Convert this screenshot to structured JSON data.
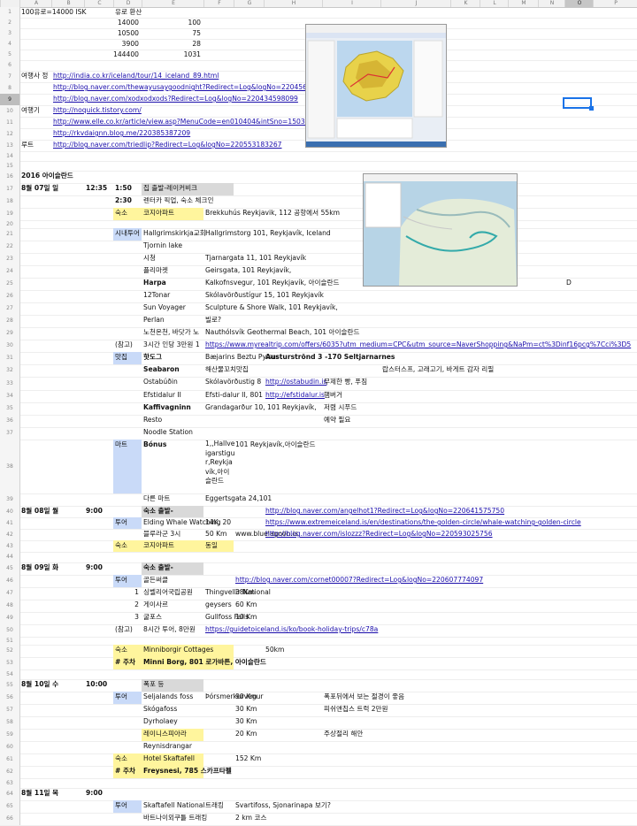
{
  "columns": [
    "A",
    "B",
    "C",
    "D",
    "E",
    "F",
    "G",
    "H",
    "I",
    "J",
    "K",
    "L",
    "M",
    "N",
    "O",
    "P"
  ],
  "selected_column": "O",
  "selected_row": 9,
  "colors": {
    "grey": "#d9d9d9",
    "yellow": "#fff59d",
    "blue": "#c9daf8",
    "link": "#1a0dab"
  },
  "rows": [
    {
      "n": 1,
      "h": 12,
      "cells": [
        {
          "c": "A",
          "t": "100유로=14000 ISK"
        },
        {
          "c": "D",
          "t": "유로 환산"
        }
      ]
    },
    {
      "n": 2,
      "h": 12,
      "cells": [
        {
          "c": "D",
          "t": "14000",
          "align": "r"
        },
        {
          "c": "E",
          "t": "100",
          "align": "r"
        }
      ]
    },
    {
      "n": 3,
      "h": 12,
      "cells": [
        {
          "c": "D",
          "t": "10500",
          "align": "r"
        },
        {
          "c": "E",
          "t": "75",
          "align": "r"
        }
      ]
    },
    {
      "n": 4,
      "h": 12,
      "cells": [
        {
          "c": "D",
          "t": "3900",
          "align": "r"
        },
        {
          "c": "E",
          "t": "28",
          "align": "r"
        }
      ]
    },
    {
      "n": 5,
      "h": 12,
      "cells": [
        {
          "c": "D",
          "t": "144400",
          "align": "r"
        },
        {
          "c": "E",
          "t": "1031",
          "align": "r"
        }
      ]
    },
    {
      "n": 6,
      "h": 12,
      "cells": []
    },
    {
      "n": 7,
      "h": 13,
      "cells": [
        {
          "c": "A",
          "t": "여행사 정"
        },
        {
          "c": "B",
          "t": "http://india.co.kr/iceland/tour/14_iceland_89.html",
          "link": true
        }
      ]
    },
    {
      "n": 8,
      "h": 13,
      "cells": [
        {
          "c": "B",
          "t": "http://blog.naver.com/thewayusaygoodnight?Redirect=Log&logNo=2204564",
          "link": true
        }
      ]
    },
    {
      "n": 9,
      "h": 13,
      "cells": [
        {
          "c": "B",
          "t": "http://blog.naver.com/xodxodxods?Redirect=Log&logNo=220434598099",
          "link": true
        }
      ]
    },
    {
      "n": 10,
      "h": 13,
      "cells": [
        {
          "c": "A",
          "t": "여행기"
        },
        {
          "c": "B",
          "t": "http://noquick.tistory.com/",
          "link": true
        }
      ]
    },
    {
      "n": 11,
      "h": 13,
      "cells": [
        {
          "c": "B",
          "t": "http://www.elle.co.kr/article/view.asp?MenuCode=en010404&intSno=15037",
          "link": true
        }
      ]
    },
    {
      "n": 12,
      "h": 13,
      "cells": [
        {
          "c": "B",
          "t": "http://rkvdaignn.blog.me/220385387209",
          "link": true
        }
      ]
    },
    {
      "n": 13,
      "h": 13,
      "cells": [
        {
          "c": "A",
          "t": "루트"
        },
        {
          "c": "B",
          "t": "http://blog.naver.com/triedlip?Redirect=Log&logNo=220553183267",
          "link": true
        }
      ]
    },
    {
      "n": 14,
      "h": 11,
      "cells": []
    },
    {
      "n": 15,
      "h": 11,
      "cells": []
    },
    {
      "n": 16,
      "h": 14,
      "cells": [
        {
          "c": "A",
          "t": "2016 아이슬란드",
          "bold": true
        }
      ]
    },
    {
      "n": 17,
      "h": 14,
      "cells": [
        {
          "c": "A",
          "t": "8월 07일 일",
          "bold": true
        },
        {
          "c": "C",
          "t": "12:35",
          "bold": true
        },
        {
          "c": "D",
          "t": "1:50",
          "bold": true
        },
        {
          "c": "E",
          "t": "집 출발-레이커비크",
          "fill": "grey",
          "span": 2
        }
      ]
    },
    {
      "n": 18,
      "h": 14,
      "cells": [
        {
          "c": "D",
          "t": "2:30",
          "bold": true
        },
        {
          "c": "E",
          "t": "렌터카 픽업, 숙소 체크인"
        }
      ]
    },
    {
      "n": 19,
      "h": 14,
      "cells": [
        {
          "c": "D",
          "t": "숙소",
          "fill": "yellow"
        },
        {
          "c": "E",
          "t": "코지아파트",
          "fill": "yellow"
        },
        {
          "c": "F",
          "t": "Brekkuhús Reykjavik, 112 공항에서 55km"
        }
      ]
    },
    {
      "n": 20,
      "h": 9,
      "cells": []
    },
    {
      "n": 21,
      "h": 14,
      "cells": [
        {
          "c": "D",
          "t": "시내투어",
          "fill": "blue"
        },
        {
          "c": "E",
          "t": "Hallgrimskirkja교회"
        },
        {
          "c": "F",
          "t": "Hallgrimstorg 101, Reykjavík, Iceland"
        }
      ]
    },
    {
      "n": 22,
      "h": 14,
      "cells": [
        {
          "c": "E",
          "t": "Tjornin lake"
        }
      ]
    },
    {
      "n": 23,
      "h": 14,
      "cells": [
        {
          "c": "E",
          "t": "시청"
        },
        {
          "c": "F",
          "t": "Tjarnargata 11, 101 Reykjavík"
        }
      ]
    },
    {
      "n": 24,
      "h": 14,
      "cells": [
        {
          "c": "E",
          "t": "플리마켓"
        },
        {
          "c": "F",
          "t": "Geirsgata, 101 Reykjavík,"
        }
      ]
    },
    {
      "n": 25,
      "h": 14,
      "cells": [
        {
          "c": "E",
          "t": "Harpa",
          "bold": true
        },
        {
          "c": "F",
          "t": "Kalkofnsvegur, 101 Reykjavík, 아이슬란드"
        },
        {
          "c": "O",
          "t": "D"
        }
      ]
    },
    {
      "n": 26,
      "h": 14,
      "cells": [
        {
          "c": "E",
          "t": "12Tonar"
        },
        {
          "c": "F",
          "t": "Skólavörðustígur 15, 101 Reykjavík"
        }
      ]
    },
    {
      "n": 27,
      "h": 14,
      "cells": [
        {
          "c": "E",
          "t": "Sun Voyager"
        },
        {
          "c": "F",
          "t": "Sculpture & Shore Walk, 101 Reykjavík,"
        }
      ]
    },
    {
      "n": 28,
      "h": 14,
      "cells": [
        {
          "c": "E",
          "t": "Perlan"
        },
        {
          "c": "F",
          "t": "빌로?"
        }
      ]
    },
    {
      "n": 29,
      "h": 14,
      "cells": [
        {
          "c": "E",
          "t": "노천온천, 바닷가 노"
        },
        {
          "c": "F",
          "t": "Nauthólsvík Geothermal Beach, 101 아이슬란드"
        }
      ]
    },
    {
      "n": 30,
      "h": 14,
      "cells": [
        {
          "c": "D",
          "t": "(참고)"
        },
        {
          "c": "E",
          "t": "3시간 인당 3만원 1"
        },
        {
          "c": "F",
          "t": "https://www.myrealtrip.com/offers/6035?utm_medium=CPC&utm_source=NaverShopping&NaPm=ct%3Dinf16pcg%7Cci%3D5",
          "link": true
        }
      ]
    },
    {
      "n": 31,
      "h": 14,
      "cells": [
        {
          "c": "D",
          "t": "맛집",
          "fill": "blue"
        },
        {
          "c": "E",
          "t": "핫도그",
          "bold": true
        },
        {
          "c": "F",
          "t": "Bæjarins Beztu Pylsur"
        },
        {
          "c": "H",
          "t": "Austurströnd 3 -170 Seltjarnarnes",
          "bold": true
        }
      ]
    },
    {
      "n": 32,
      "h": 14,
      "cells": [
        {
          "c": "E",
          "t": "Seabaron",
          "bold": true
        },
        {
          "c": "F",
          "t": "해산물꼬치맛집"
        },
        {
          "c": "J",
          "t": "랍스터스프, 고래고기, 바게트 감자 리필"
        }
      ]
    },
    {
      "n": 33,
      "h": 15,
      "cells": [
        {
          "c": "E",
          "t": "Ostabúðin"
        },
        {
          "c": "F",
          "t": "Skólavörðustig 8"
        },
        {
          "c": "H",
          "t": "http://ostabudin.is",
          "link": true
        },
        {
          "c": "I",
          "t": "무제한 빵, 푸짐"
        }
      ]
    },
    {
      "n": 34,
      "h": 14,
      "cells": [
        {
          "c": "E",
          "t": "Efstidalur II"
        },
        {
          "c": "F",
          "t": "Efsti-dalur II, 801"
        },
        {
          "c": "H",
          "t": "http://efstidalur.is",
          "link": true
        },
        {
          "c": "I",
          "t": "햄버거"
        }
      ]
    },
    {
      "n": 35,
      "h": 14,
      "cells": [
        {
          "c": "E",
          "t": "Kaffivagninn",
          "bold": true
        },
        {
          "c": "F",
          "t": "Grandagarður 10, 101 Reykjavík,"
        },
        {
          "c": "I",
          "t": "저렴 시푸드"
        }
      ]
    },
    {
      "n": 36,
      "h": 14,
      "cells": [
        {
          "c": "E",
          "t": "Resto"
        },
        {
          "c": "I",
          "t": "예약 필요"
        }
      ]
    },
    {
      "n": 37,
      "h": 14,
      "cells": [
        {
          "c": "E",
          "t": "Noodle Station"
        }
      ]
    },
    {
      "n": 38,
      "h": 61,
      "cells": [
        {
          "c": "D",
          "t": "마트",
          "fill": "blue"
        },
        {
          "c": "E",
          "t": "Bónus",
          "bold": true
        },
        {
          "c": "F",
          "t": "1,,Hallveigarstigur,Reykjavík,아이슬란드",
          "wrap": true
        },
        {
          "c": "G",
          "t": "101 Reykjavík,아이슬란드"
        }
      ]
    },
    {
      "n": 39,
      "h": 14,
      "cells": [
        {
          "c": "E",
          "t": "다른 마트"
        },
        {
          "c": "F",
          "t": "Eggertsgata 24,101"
        }
      ]
    },
    {
      "n": 40,
      "h": 13,
      "cells": [
        {
          "c": "A",
          "t": "8월 08일 월",
          "bold": true
        },
        {
          "c": "C",
          "t": "9:00",
          "bold": true
        },
        {
          "c": "E",
          "t": "숙소 출발-",
          "fill": "grey",
          "bold": true
        },
        {
          "c": "H",
          "t": "http://blog.naver.com/angelhot1?Redirect=Log&logNo=220641575750",
          "link": true
        }
      ]
    },
    {
      "n": 41,
      "h": 13,
      "cells": [
        {
          "c": "D",
          "t": "투어",
          "fill": "blue"
        },
        {
          "c": "E",
          "t": "Elding Whale Watching"
        },
        {
          "c": "F",
          "t": "14K, 20"
        },
        {
          "c": "H",
          "t": "https://www.extremeiceland.is/en/destinations/the-golden-circle/whale-watching-golden-circle",
          "link": true
        }
      ]
    },
    {
      "n": 42,
      "h": 13,
      "cells": [
        {
          "c": "E",
          "t": "블루라군 3시"
        },
        {
          "c": "F",
          "t": "50 Km"
        },
        {
          "c": "G",
          "t": "www.bluelagoon.is"
        },
        {
          "c": "H",
          "t": "http://blog.naver.com/islozzz?Redirect=Log&logNo=220593025756",
          "link": true
        }
      ]
    },
    {
      "n": 43,
      "h": 13,
      "cells": [
        {
          "c": "D",
          "t": "숙소",
          "fill": "yellow"
        },
        {
          "c": "E",
          "t": "코지아파트",
          "fill": "yellow"
        },
        {
          "c": "F",
          "t": "동일",
          "fill": "yellow"
        }
      ]
    },
    {
      "n": 44,
      "h": 12,
      "cells": []
    },
    {
      "n": 45,
      "h": 14,
      "cells": [
        {
          "c": "A",
          "t": "8월 09일 화",
          "bold": true
        },
        {
          "c": "C",
          "t": "9:00",
          "bold": true
        },
        {
          "c": "E",
          "t": "숙소 출발-",
          "fill": "grey",
          "bold": true
        }
      ]
    },
    {
      "n": 46,
      "h": 14,
      "cells": [
        {
          "c": "D",
          "t": "투어",
          "fill": "blue"
        },
        {
          "c": "E",
          "t": "골든써클"
        },
        {
          "c": "G",
          "t": "http://blog.naver.com/cornet00007?Redirect=Log&logNo=220607774097",
          "link": true
        }
      ]
    },
    {
      "n": 47,
      "h": 14,
      "cells": [
        {
          "c": "D",
          "t": "1",
          "align": "r"
        },
        {
          "c": "E",
          "t": "싱벨리어국립공원"
        },
        {
          "c": "F",
          "t": "Thingvellir National"
        },
        {
          "c": "G",
          "t": "38Km"
        }
      ]
    },
    {
      "n": 48,
      "h": 14,
      "cells": [
        {
          "c": "D",
          "t": "2",
          "align": "r"
        },
        {
          "c": "E",
          "t": "게이사르"
        },
        {
          "c": "F",
          "t": "geysers"
        },
        {
          "c": "G",
          "t": "60 Km"
        }
      ]
    },
    {
      "n": 49,
      "h": 14,
      "cells": [
        {
          "c": "D",
          "t": "3",
          "align": "r"
        },
        {
          "c": "E",
          "t": "굴포스"
        },
        {
          "c": "F",
          "t": "Gullfoss Falls"
        },
        {
          "c": "G",
          "t": "10 Km"
        }
      ]
    },
    {
      "n": 50,
      "h": 14,
      "cells": [
        {
          "c": "D",
          "t": "(참고)"
        },
        {
          "c": "E",
          "t": "8시간 투어, 8만원"
        },
        {
          "c": "F",
          "t": "https://guidetoiceland.is/ko/book-holiday-trips/c78a",
          "link": true
        }
      ]
    },
    {
      "n": 51,
      "h": 9,
      "cells": []
    },
    {
      "n": 52,
      "h": 14,
      "cells": [
        {
          "c": "D",
          "t": "숙소",
          "fill": "yellow"
        },
        {
          "c": "E",
          "t": "Minniborgir Cottages",
          "fill": "yellow",
          "span": 2
        },
        {
          "c": "H",
          "t": "50km"
        }
      ]
    },
    {
      "n": 53,
      "h": 14,
      "cells": [
        {
          "c": "D",
          "t": "# 주차",
          "fill": "yellow",
          "bold": true
        },
        {
          "c": "E",
          "t": "Minni Borg, 801 로가바튼, 아이슬란드",
          "fill": "yellow",
          "bold": true,
          "span": 2
        }
      ]
    },
    {
      "n": 54,
      "h": 11,
      "cells": []
    },
    {
      "n": 55,
      "h": 14,
      "cells": [
        {
          "c": "A",
          "t": "8월 10일 수",
          "bold": true
        },
        {
          "c": "C",
          "t": "10:00",
          "bold": true
        },
        {
          "c": "E",
          "t": "폭포 등",
          "fill": "grey"
        }
      ]
    },
    {
      "n": 56,
      "h": 14,
      "cells": [
        {
          "c": "D",
          "t": "투어",
          "fill": "blue"
        },
        {
          "c": "E",
          "t": "Seljalands foss"
        },
        {
          "c": "F",
          "t": "Þórsmerkurvegur"
        },
        {
          "c": "G",
          "t": "90 Km"
        },
        {
          "c": "I",
          "t": "폭포뒤에서 보는 절경이 좋음"
        }
      ]
    },
    {
      "n": 57,
      "h": 14,
      "cells": [
        {
          "c": "E",
          "t": "Skógafoss"
        },
        {
          "c": "G",
          "t": "30 Km"
        },
        {
          "c": "I",
          "t": "피쉬앤칩스 트럭 2만원"
        }
      ]
    },
    {
      "n": 58,
      "h": 14,
      "cells": [
        {
          "c": "E",
          "t": "Dyrholaey"
        },
        {
          "c": "G",
          "t": "30 Km"
        }
      ]
    },
    {
      "n": 59,
      "h": 14,
      "cells": [
        {
          "c": "E",
          "t": "레이니스피아라",
          "fill": "yellow"
        },
        {
          "c": "G",
          "t": "20 Km"
        },
        {
          "c": "I",
          "t": "주상절리 해안"
        }
      ]
    },
    {
      "n": 60,
      "h": 14,
      "cells": [
        {
          "c": "E",
          "t": "Reynisdrangar"
        }
      ]
    },
    {
      "n": 61,
      "h": 14,
      "cells": [
        {
          "c": "D",
          "t": "숙소",
          "fill": "yellow"
        },
        {
          "c": "E",
          "t": "Hotel Skaftafell",
          "fill": "yellow"
        },
        {
          "c": "G",
          "t": "152 Km"
        }
      ]
    },
    {
      "n": 62,
      "h": 14,
      "cells": [
        {
          "c": "D",
          "t": "# 주차",
          "fill": "yellow",
          "bold": true
        },
        {
          "c": "E",
          "t": "Freysnesi, 785 스카프타펠",
          "fill": "yellow",
          "bold": true
        }
      ]
    },
    {
      "n": 63,
      "h": 11,
      "cells": []
    },
    {
      "n": 64,
      "h": 14,
      "cells": [
        {
          "c": "A",
          "t": "8월 11일 목",
          "bold": true
        },
        {
          "c": "C",
          "t": "9:00",
          "bold": true
        }
      ]
    },
    {
      "n": 65,
      "h": 14,
      "cells": [
        {
          "c": "D",
          "t": "투어",
          "fill": "blue"
        },
        {
          "c": "E",
          "t": "Skaftafell National"
        },
        {
          "c": "F",
          "t": "트래킹"
        },
        {
          "c": "G",
          "t": "Svartifoss, Sjonarinapa 보기?"
        }
      ]
    },
    {
      "n": 66,
      "h": 14,
      "cells": [
        {
          "c": "E",
          "t": "바트나이외쿠틀 트래킹"
        },
        {
          "c": "G",
          "t": "2 km 코스"
        }
      ]
    }
  ],
  "images": {
    "map1_label": "iceland-route-map-screenshot",
    "map2_label": "reykjavik-area-map-screenshot"
  }
}
